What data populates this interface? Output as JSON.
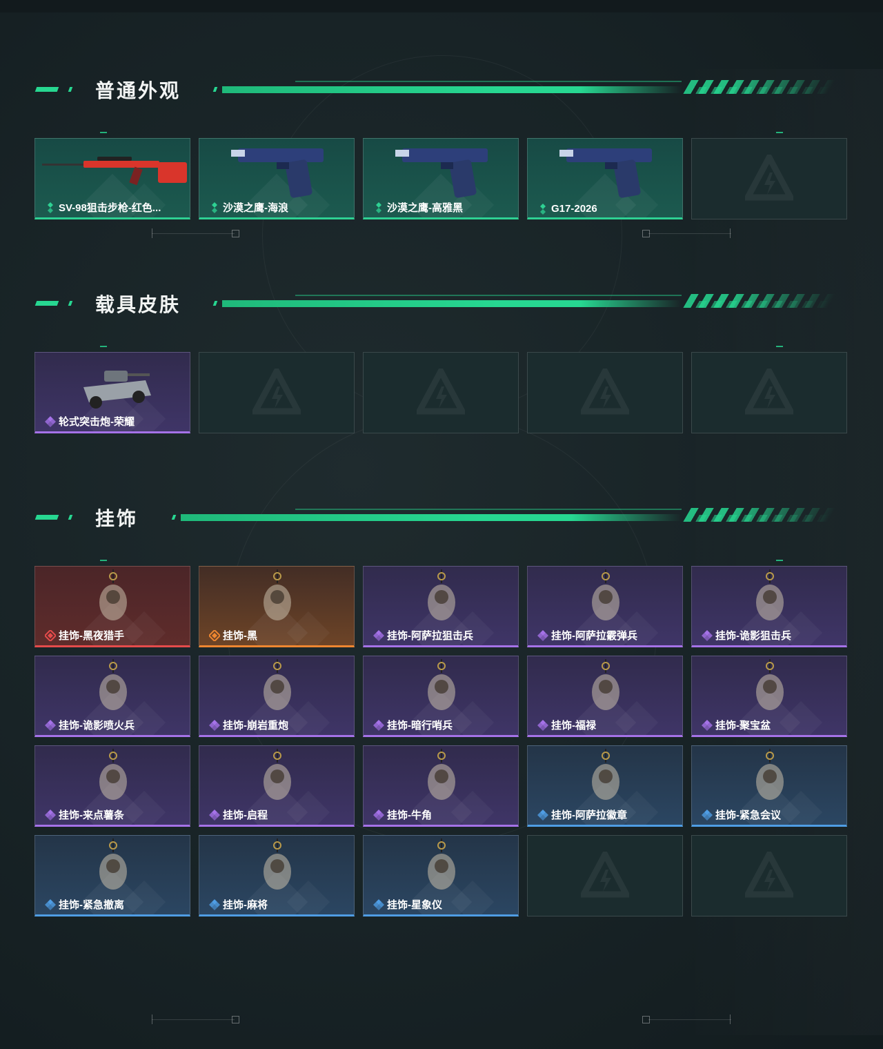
{
  "sections": [
    {
      "title": "普通外观",
      "items": [
        {
          "label": "SV-98狙击步枪-红色...",
          "rarity": "green",
          "icon": "sniper-rifle-icon"
        },
        {
          "label": "沙漠之鹰-海浪",
          "rarity": "green",
          "icon": "pistol-icon"
        },
        {
          "label": "沙漠之鹰-高雅黑",
          "rarity": "green",
          "icon": "pistol-icon"
        },
        {
          "label": "G17-2026",
          "rarity": "green",
          "icon": "pistol-icon"
        },
        {
          "label": "",
          "rarity": "empty"
        }
      ]
    },
    {
      "title": "载具皮肤",
      "items": [
        {
          "label": "轮式突击炮-荣耀",
          "rarity": "purple",
          "icon": "armored-vehicle-icon"
        },
        {
          "label": "",
          "rarity": "empty"
        },
        {
          "label": "",
          "rarity": "empty"
        },
        {
          "label": "",
          "rarity": "empty"
        },
        {
          "label": "",
          "rarity": "empty"
        }
      ]
    },
    {
      "title": "挂饰",
      "items": [
        {
          "label": "挂饰-黑夜猎手",
          "rarity": "red",
          "icon": "charm-icon"
        },
        {
          "label": "挂饰-黑",
          "rarity": "orange",
          "icon": "charm-icon"
        },
        {
          "label": "挂饰-阿萨拉狙击兵",
          "rarity": "purple",
          "icon": "charm-icon"
        },
        {
          "label": "挂饰-阿萨拉霰弹兵",
          "rarity": "purple",
          "icon": "charm-icon"
        },
        {
          "label": "挂饰-诡影狙击兵",
          "rarity": "purple",
          "icon": "charm-icon"
        },
        {
          "label": "挂饰-诡影喷火兵",
          "rarity": "purple",
          "icon": "charm-icon"
        },
        {
          "label": "挂饰-崩岩重炮",
          "rarity": "purple",
          "icon": "charm-icon"
        },
        {
          "label": "挂饰-暗行哨兵",
          "rarity": "purple",
          "icon": "charm-icon"
        },
        {
          "label": "挂饰-福禄",
          "rarity": "purple",
          "icon": "charm-icon"
        },
        {
          "label": "挂饰-聚宝盆",
          "rarity": "purple",
          "icon": "charm-icon"
        },
        {
          "label": "挂饰-来点薯条",
          "rarity": "purple",
          "icon": "charm-icon"
        },
        {
          "label": "挂饰-启程",
          "rarity": "purple",
          "icon": "charm-icon"
        },
        {
          "label": "挂饰-牛角",
          "rarity": "purple",
          "icon": "charm-icon"
        },
        {
          "label": "挂饰-阿萨拉徽章",
          "rarity": "blue",
          "icon": "charm-icon"
        },
        {
          "label": "挂饰-紧急会议",
          "rarity": "blue",
          "icon": "charm-icon"
        },
        {
          "label": "挂饰-紧急撤离",
          "rarity": "blue",
          "icon": "charm-icon"
        },
        {
          "label": "挂饰-麻将",
          "rarity": "blue",
          "icon": "charm-icon"
        },
        {
          "label": "挂饰-星象仪",
          "rarity": "blue",
          "icon": "charm-icon"
        },
        {
          "label": "",
          "rarity": "empty"
        },
        {
          "label": "",
          "rarity": "empty"
        }
      ]
    }
  ],
  "colors": {
    "accent": "#27d791",
    "green": "#2ed193",
    "purple": "#a572e8",
    "red": "#e54b4b",
    "orange": "#ee8630",
    "blue": "#4f9de4"
  }
}
